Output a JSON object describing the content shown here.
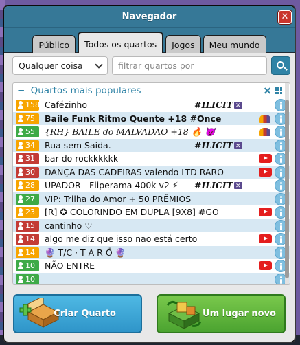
{
  "window": {
    "title": "Navegador",
    "close_label": "✕"
  },
  "tabs": [
    {
      "label": "Público",
      "active": false
    },
    {
      "label": "Todos os quartos",
      "active": true
    },
    {
      "label": "Jogos",
      "active": false
    },
    {
      "label": "Meu mundo",
      "active": false
    }
  ],
  "filters": {
    "select_value": "Qualquer coisa",
    "search_placeholder": "filtrar quartos por"
  },
  "category": {
    "title": "Quartos mais populares",
    "collapse_symbol": "−"
  },
  "rooms": [
    {
      "count": "158",
      "status": "orange",
      "name": "Cafézinho",
      "tag": "#ILICIT",
      "tag_icon": true,
      "yt": false,
      "group": false
    },
    {
      "count": "75",
      "status": "orange",
      "name": "Baile Funk Ritmo Quente +18 #Once",
      "bold": true,
      "tag": "",
      "yt": false,
      "group": true
    },
    {
      "count": "55",
      "status": "green",
      "name": "{RH} BAILE do MALVADAO +18 🔥 😈",
      "italic": true,
      "tag": "",
      "yt": false,
      "group": true
    },
    {
      "count": "34",
      "status": "orange",
      "name": "Rua sem Saida.",
      "tag": "#ILICIT",
      "tag_icon": true,
      "yt": false,
      "group": false
    },
    {
      "count": "31",
      "status": "red",
      "name": "bar do rockkkkkk",
      "tag": "",
      "yt": true,
      "group": false
    },
    {
      "count": "30",
      "status": "red",
      "name": "DANÇA DAS CADEIRAS valendo LTD RARO",
      "tag": "",
      "yt": true,
      "group": false
    },
    {
      "count": "28",
      "status": "orange",
      "name": "UPADOR - Fliperama 400k v2 ⚡",
      "tag": "#ILICIT",
      "tag_icon": true,
      "yt": false,
      "group": false
    },
    {
      "count": "27",
      "status": "green",
      "name": "VIP: Trilha do Amor + 50 PRÊMIOS",
      "tag": "",
      "yt": false,
      "group": false
    },
    {
      "count": "23",
      "status": "orange",
      "name": "[R] ✪ COLORINDO EM DUPLA [9X8] #GO",
      "tag": "",
      "yt": true,
      "group": false
    },
    {
      "count": "15",
      "status": "red",
      "name": "cantinho ♡",
      "tag": "",
      "yt": false,
      "group": false
    },
    {
      "count": "14",
      "status": "red",
      "name": "algo me diz que isso nao está certo",
      "tag": "",
      "yt": true,
      "group": false
    },
    {
      "count": "14",
      "status": "orange",
      "name": "           🔮 T/C · T A R Ö 🔮",
      "tag": "",
      "yt": false,
      "group": false
    },
    {
      "count": "10",
      "status": "green",
      "name": "NÃO ENTRE",
      "tag": "",
      "yt": true,
      "group": false
    },
    {
      "count": "10",
      "status": "green",
      "name": "",
      "tag": "",
      "yt": false,
      "group": false
    }
  ],
  "buttons": {
    "create_room": "Criar Quarto",
    "random_room": "Um lugar novo"
  },
  "colors": {
    "titlebar": "#367897",
    "accent": "#2f83a6",
    "badge_orange": "#f7a400",
    "badge_red": "#c33b35",
    "badge_green": "#3eaa47",
    "create_btn": "#3ba6d6",
    "random_btn": "#5eb63a"
  }
}
